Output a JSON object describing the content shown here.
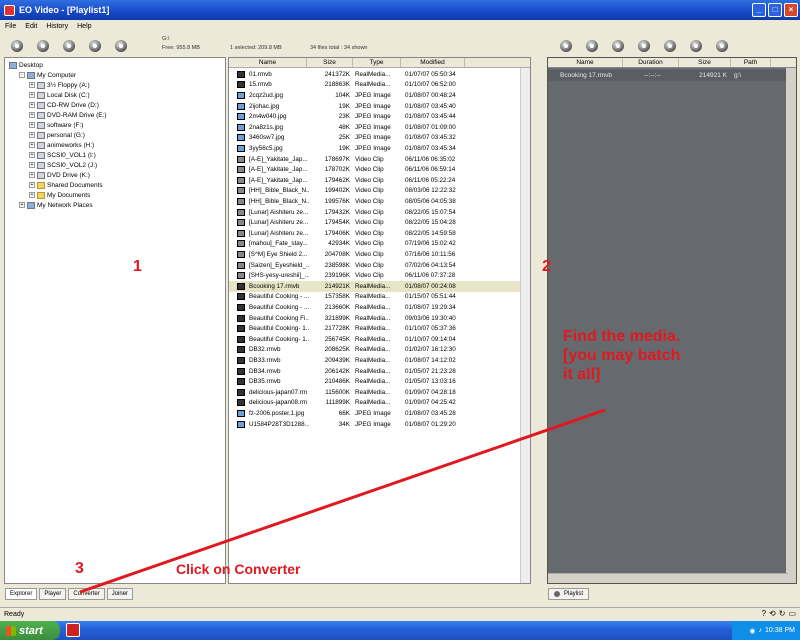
{
  "window": {
    "title": "EO Video - [Playlist1]"
  },
  "menu": [
    "File",
    "Edit",
    "History",
    "Help"
  ],
  "info": {
    "drive": "G:\\",
    "free": "Free: 955.8 MB",
    "selected": "1 selected: 209.8 MB",
    "total": "34 files total : 34 shown"
  },
  "tree": [
    {
      "label": "Desktop",
      "icon": "desktop-icon",
      "level": 0,
      "expander": ""
    },
    {
      "label": "My Computer",
      "icon": "computer-icon",
      "level": 1,
      "expander": "-"
    },
    {
      "label": "3½ Floppy (A:)",
      "icon": "floppy-icon",
      "level": 2,
      "expander": "+"
    },
    {
      "label": "Local Disk (C:)",
      "icon": "disk-icon",
      "level": 2,
      "expander": "+"
    },
    {
      "label": "CD-RW Drive (D:)",
      "icon": "cd-icon",
      "level": 2,
      "expander": "+"
    },
    {
      "label": "DVD-RAM Drive (E:)",
      "icon": "dvd-icon",
      "level": 2,
      "expander": "+"
    },
    {
      "label": "software (F:)",
      "icon": "disk-icon",
      "level": 2,
      "expander": "+"
    },
    {
      "label": "personal (G:)",
      "icon": "disk-icon",
      "level": 2,
      "expander": "+"
    },
    {
      "label": "animeworks (H:)",
      "icon": "disk-icon",
      "level": 2,
      "expander": "+"
    },
    {
      "label": "SCSI0_VOL1 (I:)",
      "icon": "disk-icon",
      "level": 2,
      "expander": "+"
    },
    {
      "label": "SCSI0_VOL2 (J:)",
      "icon": "disk-icon",
      "level": 2,
      "expander": "+"
    },
    {
      "label": "DVD Drive (K:)",
      "icon": "dvd-icon",
      "level": 2,
      "expander": "+"
    },
    {
      "label": "Shared Documents",
      "icon": "folder-icon",
      "level": 2,
      "expander": "+"
    },
    {
      "label": "My Documents",
      "icon": "folder-icon",
      "level": 2,
      "expander": "+"
    },
    {
      "label": "My Network Places",
      "icon": "network-icon",
      "level": 1,
      "expander": "+"
    }
  ],
  "files": {
    "headers": [
      "Name",
      "Size",
      "Type",
      "Modified"
    ],
    "rows": [
      {
        "name": "01.rmvb",
        "size": "241372K",
        "type": "RealMedia...",
        "modified": "01/07/07 05:50:34",
        "kind": "rm"
      },
      {
        "name": "15.rmvb",
        "size": "218863K",
        "type": "RealMedia...",
        "modified": "01/10/07 06:52:00",
        "kind": "rm"
      },
      {
        "name": "2cqz2ud.jpg",
        "size": "104K",
        "type": "JPEG Image",
        "modified": "01/08/07 00:48:24",
        "kind": "jpg"
      },
      {
        "name": "2ijohac.jpg",
        "size": "19K",
        "type": "JPEG Image",
        "modified": "01/08/07 03:45:40",
        "kind": "jpg"
      },
      {
        "name": "2m4w040.jpg",
        "size": "23K",
        "type": "JPEG Image",
        "modified": "01/08/07 03:45:44",
        "kind": "jpg"
      },
      {
        "name": "2na8z1s.jpg",
        "size": "48K",
        "type": "JPEG Image",
        "modified": "01/08/07 01:09:00",
        "kind": "jpg"
      },
      {
        "name": "3460sw7.jpg",
        "size": "25K",
        "type": "JPEG Image",
        "modified": "01/08/07 03:45:32",
        "kind": "jpg"
      },
      {
        "name": "3yy56c5.jpg",
        "size": "19K",
        "type": "JPEG Image",
        "modified": "01/08/07 03:45:34",
        "kind": "jpg"
      },
      {
        "name": "[A-E]_Yakitate_Jap...",
        "size": "178697K",
        "type": "Video Clip",
        "modified": "06/11/06 06:35:02",
        "kind": "vid"
      },
      {
        "name": "[A-E]_Yakitate_Jap...",
        "size": "178702K",
        "type": "Video Clip",
        "modified": "06/11/06 06:59:14",
        "kind": "vid"
      },
      {
        "name": "[A-E]_Yakitate_Jap...",
        "size": "179462K",
        "type": "Video Clip",
        "modified": "06/11/06 05:22:24",
        "kind": "vid"
      },
      {
        "name": "[HH]_Bible_Black_N...",
        "size": "199402K",
        "type": "Video Clip",
        "modified": "08/03/06 12:22:32",
        "kind": "vid"
      },
      {
        "name": "[HH]_Bible_Black_N...",
        "size": "199576K",
        "type": "Video Clip",
        "modified": "08/05/06 04:05:38",
        "kind": "vid"
      },
      {
        "name": "[Lunar] Aishiteru ze...",
        "size": "179432K",
        "type": "Video Clip",
        "modified": "08/22/05 15:07:54",
        "kind": "vid"
      },
      {
        "name": "[Lunar] Aishiteru ze...",
        "size": "179454K",
        "type": "Video Clip",
        "modified": "08/22/05 15:04:28",
        "kind": "vid"
      },
      {
        "name": "[Lunar] Aishiteru ze...",
        "size": "179406K",
        "type": "Video Clip",
        "modified": "08/22/05 14:59:58",
        "kind": "vid"
      },
      {
        "name": "[mahou]_Fate_stay...",
        "size": "42934K",
        "type": "Video Clip",
        "modified": "07/19/06 15:02:42",
        "kind": "vid"
      },
      {
        "name": "[S^M] Eye Shield 2...",
        "size": "204708K",
        "type": "Video Clip",
        "modified": "07/16/06 10:11:56",
        "kind": "vid"
      },
      {
        "name": "[Saizen]_Eyeshield_...",
        "size": "238598K",
        "type": "Video Clip",
        "modified": "07/02/06 04:13:54",
        "kind": "vid"
      },
      {
        "name": "[SHS-yesy-ureshii]_...",
        "size": "239196K",
        "type": "Video Clip",
        "modified": "06/11/06 07:37:28",
        "kind": "vid"
      },
      {
        "name": "Bcooking 17.rmvb",
        "size": "214921K",
        "type": "RealMedia...",
        "modified": "01/08/07 00:24:08",
        "kind": "rm",
        "selected": true
      },
      {
        "name": "Beautiful Cooking - ...",
        "size": "157358K",
        "type": "RealMedia...",
        "modified": "01/15/07 05:51:44",
        "kind": "rm"
      },
      {
        "name": "Beautiful Cooking - ...",
        "size": "213660K",
        "type": "RealMedia...",
        "modified": "01/08/07 19:29:34",
        "kind": "rm"
      },
      {
        "name": "Beautiful Cooking Fi...",
        "size": "321899K",
        "type": "RealMedia...",
        "modified": "09/03/06 19:30:40",
        "kind": "rm"
      },
      {
        "name": "Beautiful Cooking- 1...",
        "size": "217728K",
        "type": "RealMedia...",
        "modified": "01/10/07 05:37:36",
        "kind": "rm"
      },
      {
        "name": "Beautiful Cooking- 1...",
        "size": "256745K",
        "type": "RealMedia...",
        "modified": "01/10/07 09:14:04",
        "kind": "rm"
      },
      {
        "name": "DB32.rmvb",
        "size": "208625K",
        "type": "RealMedia...",
        "modified": "01/02/07 16:12:30",
        "kind": "rm"
      },
      {
        "name": "DB33.rmvb",
        "size": "209439K",
        "type": "RealMedia...",
        "modified": "01/08/07 14:12:02",
        "kind": "rm"
      },
      {
        "name": "DB34.rmvb",
        "size": "206142K",
        "type": "RealMedia...",
        "modified": "01/05/07 21:23:28",
        "kind": "rm"
      },
      {
        "name": "DB35.rmvb",
        "size": "210486K",
        "type": "RealMedia...",
        "modified": "01/05/07 13:03:16",
        "kind": "rm"
      },
      {
        "name": "delicious-japan07.rm",
        "size": "115600K",
        "type": "RealMedia...",
        "modified": "01/09/07 04:28:18",
        "kind": "rm"
      },
      {
        "name": "delicious-japan08.rm",
        "size": "111899K",
        "type": "RealMedia...",
        "modified": "01/09/07 04:25:42",
        "kind": "rm"
      },
      {
        "name": "fz-2006.poster.1.jpg",
        "size": "66K",
        "type": "JPEG Image",
        "modified": "01/08/07 03:45:28",
        "kind": "jpg"
      },
      {
        "name": "U1584P28T3D1288...",
        "size": "34K",
        "type": "JPEG Image",
        "modified": "01/08/07 01:29:20",
        "kind": "jpg"
      }
    ]
  },
  "playlist": {
    "headers": [
      "Name",
      "Duration",
      "Size",
      "Path"
    ],
    "rows": [
      {
        "name": "Bcooking 17.rmvb",
        "duration": "--:--:--",
        "size": "214921 K",
        "path": "g:\\"
      }
    ]
  },
  "left_tabs": [
    "Explorer",
    "Player",
    "Converter",
    "Joiner"
  ],
  "right_tab": "Playlist",
  "status": "Ready",
  "clock": "10:38 PM",
  "start_label": "start",
  "annotations": {
    "n1": "1",
    "n2": "2",
    "n3": "3",
    "find_line1": "Find the media.",
    "find_line2": "[you may batch",
    "find_line3": "it all]",
    "click": "Click on Converter"
  },
  "colors": {
    "annotation": "#e0181f",
    "playlist_bg": "#666a6e"
  }
}
